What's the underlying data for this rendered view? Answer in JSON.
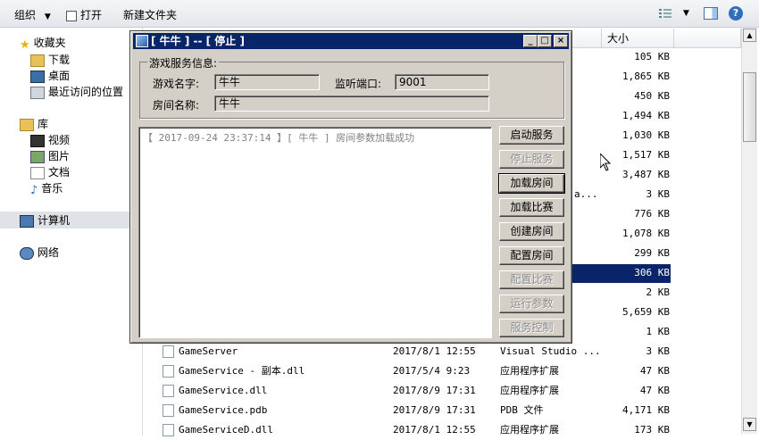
{
  "toolbar": {
    "organize": "组织",
    "open": "打开",
    "new_folder": "新建文件夹"
  },
  "nav": {
    "favorites": "收藏夹",
    "downloads": "下载",
    "desktop": "桌面",
    "recent": "最近访问的位置",
    "library": "库",
    "videos": "视频",
    "pictures": "图片",
    "documents": "文档",
    "music": "音乐",
    "computer": "计算机",
    "network": "网络"
  },
  "columns": {
    "size": "大小"
  },
  "partial_rows": {
    "sizes": [
      "105 KB",
      "1,865 KB",
      "450 KB",
      "1,494 KB",
      "1,030 KB",
      "1,517 KB",
      "3,487 KB",
      "3 KB",
      "776 KB",
      "1,078 KB",
      "299 KB",
      "306 KB",
      "2 KB",
      "5,659 KB",
      "1 KB"
    ],
    "truncated_type": "a..."
  },
  "rows": [
    {
      "name": "GameServer",
      "date": "2017/8/1 12:55",
      "type": "Visual Studio ...",
      "size": "3 KB"
    },
    {
      "name": "GameService - 副本.dll",
      "date": "2017/5/4 9:23",
      "type": "应用程序扩展",
      "size": "47 KB"
    },
    {
      "name": "GameService.dll",
      "date": "2017/8/9 17:31",
      "type": "应用程序扩展",
      "size": "47 KB"
    },
    {
      "name": "GameService.pdb",
      "date": "2017/8/9 17:31",
      "type": "PDB 文件",
      "size": "4,171 KB"
    },
    {
      "name": "GameServiceD.dll",
      "date": "2017/8/1 12:55",
      "type": "应用程序扩展",
      "size": "173 KB"
    }
  ],
  "dialog": {
    "title": "[ 牛牛 ] -- [ 停止 ]",
    "group_title": "游戏服务信息:",
    "game_name_label": "游戏名字:",
    "game_name_value": "牛牛",
    "port_label": "监听端口:",
    "port_value": "9001",
    "room_name_label": "房间名称:",
    "room_name_value": "牛牛",
    "log_line": "【 2017-09-24 23:37:14 】[ 牛牛 ] 房间参数加载成功",
    "buttons": {
      "start": "启动服务",
      "stop": "停止服务",
      "load_room": "加载房间",
      "load_match": "加载比赛",
      "create_room": "创建房间",
      "config_room": "配置房间",
      "config_match": "配置比赛",
      "run_params": "运行参数",
      "service_control": "服务控制"
    }
  }
}
